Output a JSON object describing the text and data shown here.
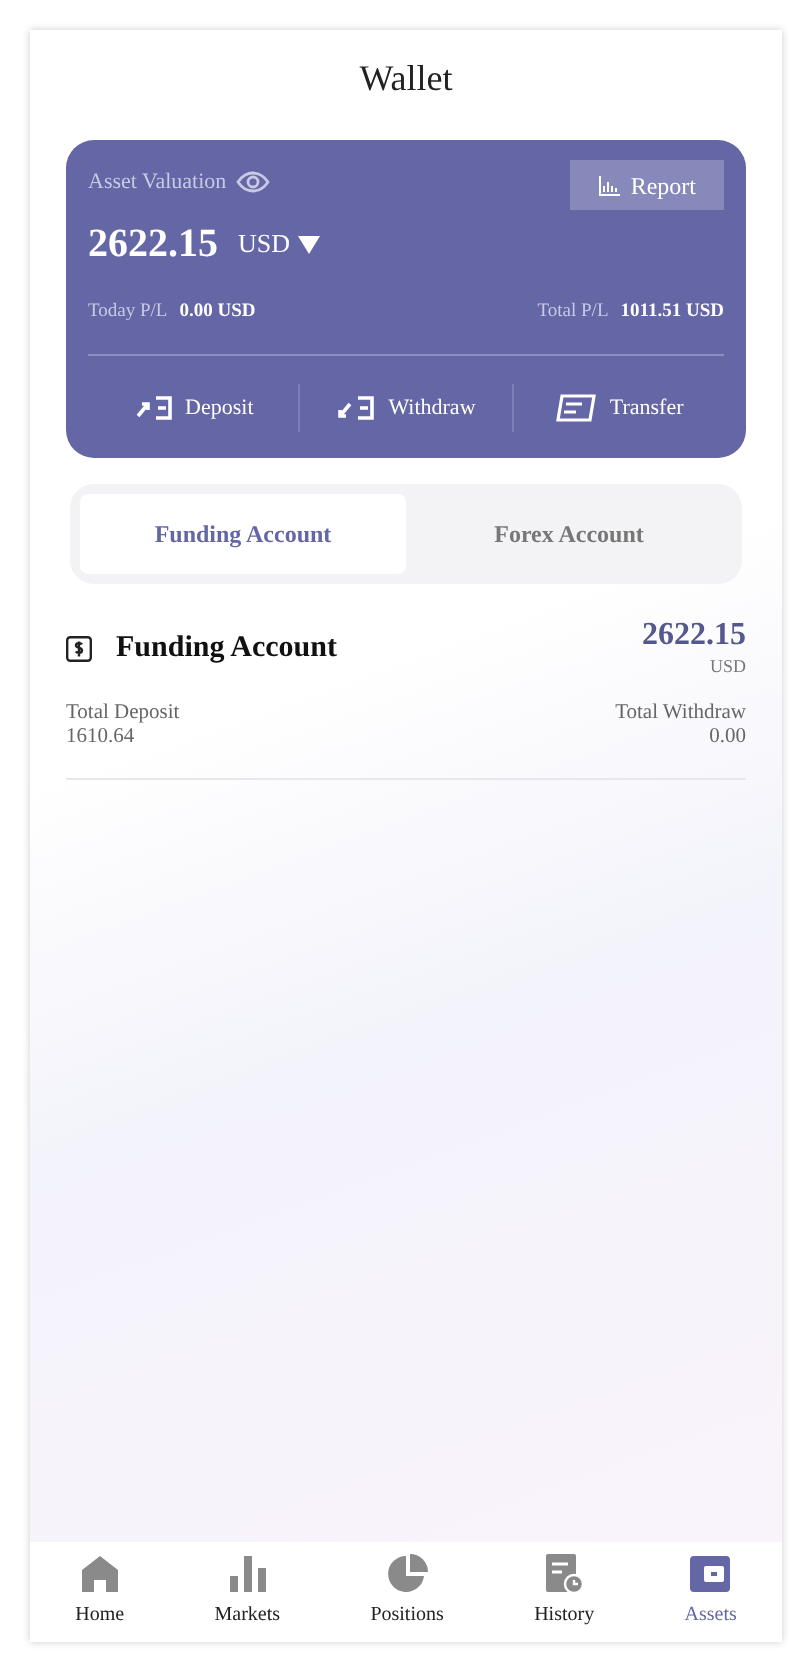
{
  "title": "Wallet",
  "summary": {
    "label": "Asset Valuation",
    "report": "Report",
    "amount": "2622.15",
    "currency": "USD",
    "today_label": "Today P/L",
    "today_value": "0.00 USD",
    "total_label": "Total P/L",
    "total_value": "1011.51 USD"
  },
  "actions": [
    {
      "kind": "deposit",
      "label": "Deposit"
    },
    {
      "kind": "withdraw",
      "label": "Withdraw"
    },
    {
      "kind": "transfer",
      "label": "Transfer"
    }
  ],
  "tabs": [
    {
      "label": "Funding Account",
      "selected": true
    },
    {
      "label": "Forex Account",
      "selected": false
    }
  ],
  "account": {
    "name": "Funding Account",
    "amount": "2622.15",
    "currency": "USD",
    "deposit_label": "Total Deposit",
    "deposit_value": "1610.64",
    "withdraw_label": "Total Withdraw",
    "withdraw_value": "0.00"
  },
  "nav": [
    {
      "kind": "home",
      "label": "Home",
      "selected": false
    },
    {
      "kind": "markets",
      "label": "Markets",
      "selected": false
    },
    {
      "kind": "positions",
      "label": "Positions",
      "selected": false
    },
    {
      "kind": "history",
      "label": "History",
      "selected": false
    },
    {
      "kind": "assets",
      "label": "Assets",
      "selected": true
    }
  ]
}
